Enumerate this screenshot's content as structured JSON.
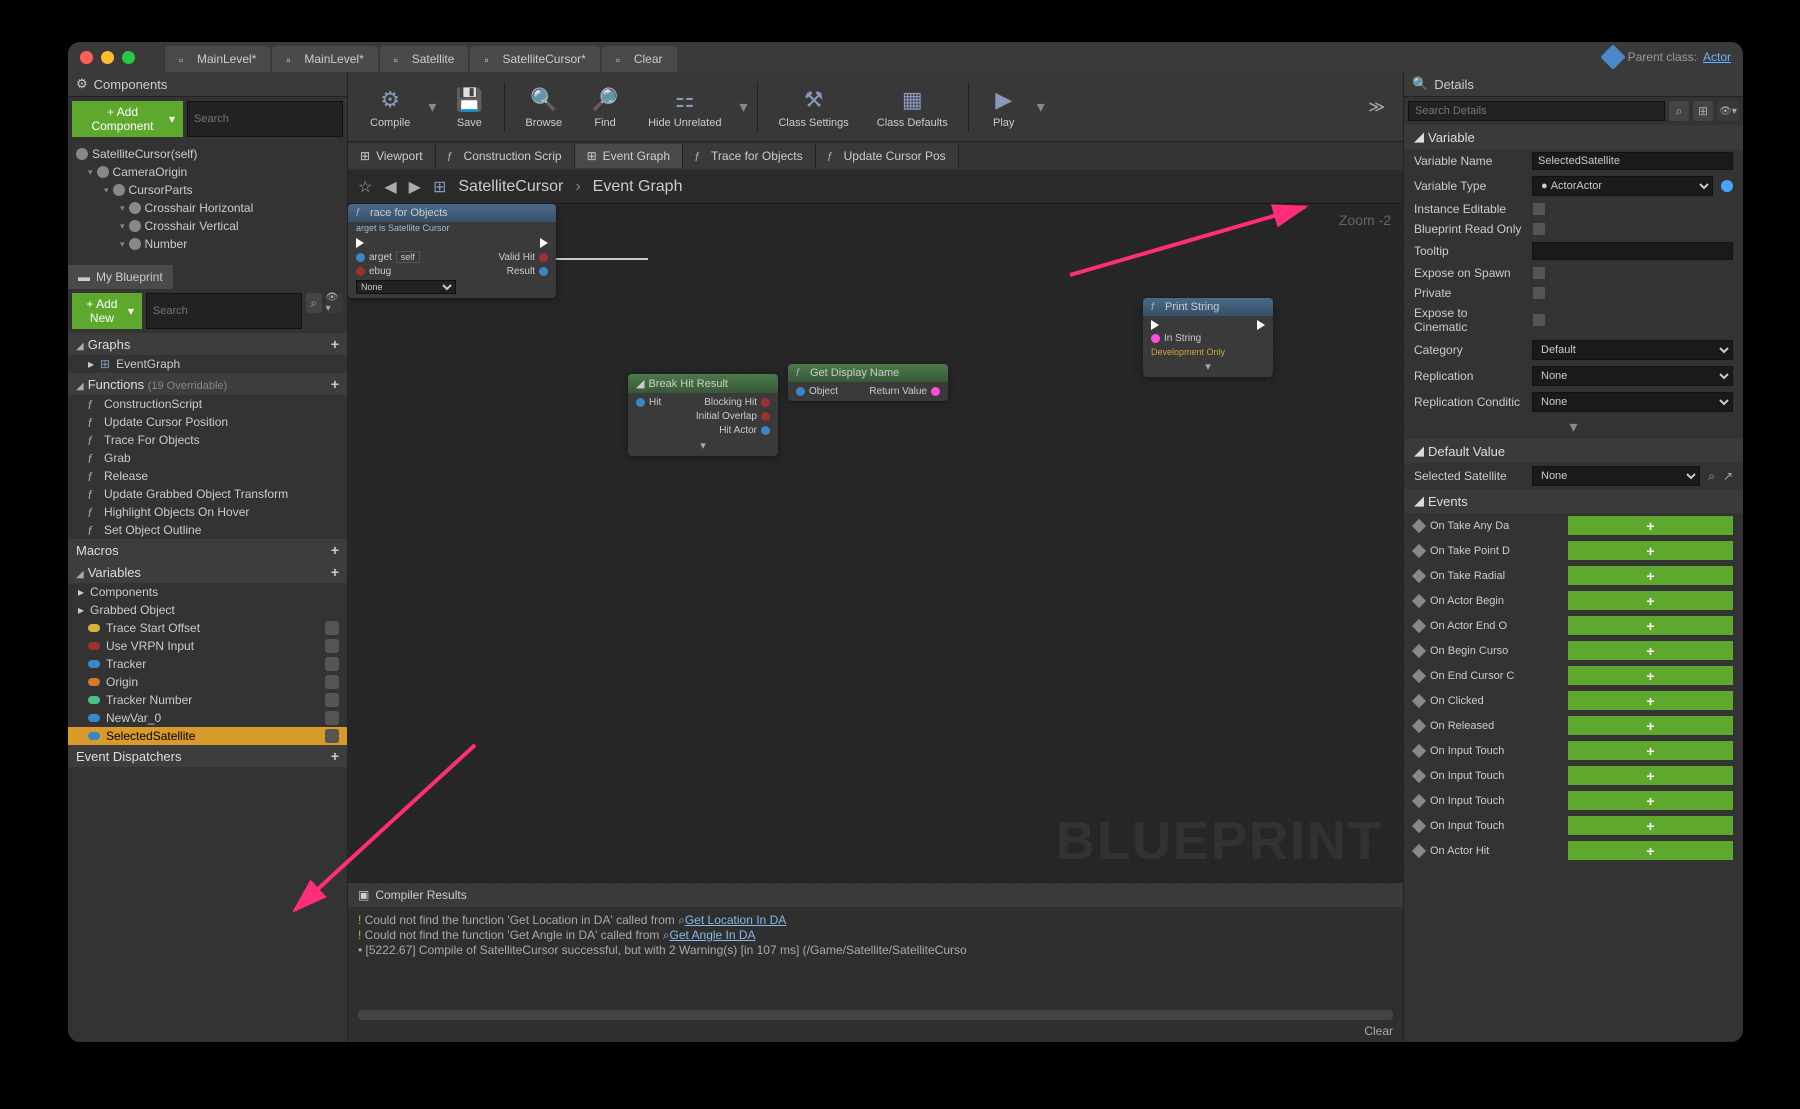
{
  "titlebar": {
    "tabs": [
      {
        "icon": "level",
        "label": "MainLevel*"
      },
      {
        "icon": "level",
        "label": "MainLevel*"
      },
      {
        "icon": "bp",
        "label": "Satellite"
      },
      {
        "icon": "bp",
        "label": "SatelliteCursor*"
      },
      {
        "icon": "doc",
        "label": "Clear"
      }
    ],
    "parent_class_label": "Parent class:",
    "parent_class": "Actor"
  },
  "components": {
    "header": "Components",
    "add_btn": "+ Add Component",
    "search_ph": "Search",
    "tree": [
      {
        "label": "SatelliteCursor(self)",
        "indent": 0,
        "icon": "sphere"
      },
      {
        "label": "CameraOrigin",
        "indent": 1,
        "icon": "link"
      },
      {
        "label": "CursorParts",
        "indent": 2,
        "icon": "link"
      },
      {
        "label": "Crosshair Horizontal",
        "indent": 3,
        "icon": "mesh"
      },
      {
        "label": "Crosshair Vertical",
        "indent": 3,
        "icon": "mesh"
      },
      {
        "label": "Number",
        "indent": 3,
        "icon": "text"
      }
    ]
  },
  "myblueprint": {
    "tab": "My Blueprint",
    "add_btn": "+ Add New",
    "search_ph": "Search",
    "sections": {
      "graphs": {
        "label": "Graphs",
        "items": [
          {
            "label": "EventGraph",
            "icon": "graph"
          }
        ]
      },
      "functions": {
        "label": "Functions",
        "suffix": "(19 Overridable)",
        "items": [
          {
            "label": "ConstructionScript"
          },
          {
            "label": "Update Cursor Position"
          },
          {
            "label": "Trace For Objects"
          },
          {
            "label": "Grab"
          },
          {
            "label": "Release"
          },
          {
            "label": "Update Grabbed Object Transform"
          },
          {
            "label": "Highlight Objects On Hover"
          },
          {
            "label": "Set Object Outline"
          }
        ]
      },
      "macros": {
        "label": "Macros"
      },
      "variables": {
        "label": "Variables",
        "groups": [
          {
            "label": "Components"
          },
          {
            "label": "Grabbed Object"
          }
        ],
        "items": [
          {
            "label": "Trace Start Offset",
            "color": "#d8b23a"
          },
          {
            "label": "Use VRPN Input",
            "color": "#a03030"
          },
          {
            "label": "Tracker",
            "color": "#3888c8"
          },
          {
            "label": "Origin",
            "color": "#d87828"
          },
          {
            "label": "Tracker Number",
            "color": "#48c088"
          },
          {
            "label": "NewVar_0",
            "color": "#3888c8"
          },
          {
            "label": "SelectedSatellite",
            "color": "#3888c8",
            "selected": true
          }
        ]
      },
      "dispatchers": {
        "label": "Event Dispatchers"
      }
    }
  },
  "toolbar": {
    "buttons": [
      {
        "label": "Compile",
        "icon": "compile",
        "dd": true
      },
      {
        "label": "Save",
        "icon": "save"
      },
      {
        "label": "Browse",
        "icon": "browse"
      },
      {
        "label": "Find",
        "icon": "find"
      },
      {
        "label": "Hide Unrelated",
        "icon": "hide",
        "dd": true
      },
      {
        "label": "Class Settings",
        "icon": "settings"
      },
      {
        "label": "Class Defaults",
        "icon": "defaults"
      },
      {
        "label": "Play",
        "icon": "play",
        "dd": true
      }
    ]
  },
  "subtabs": [
    {
      "label": "Viewport",
      "icon": "vp"
    },
    {
      "label": "Construction Scrip",
      "icon": "f"
    },
    {
      "label": "Event Graph",
      "icon": "eg",
      "active": true
    },
    {
      "label": "Trace for Objects",
      "icon": "f"
    },
    {
      "label": "Update Cursor Pos",
      "icon": "f"
    }
  ],
  "breadcrumb": {
    "a": "SatelliteCursor",
    "b": "Event Graph",
    "zoom": "Zoom -2"
  },
  "graph": {
    "watermark": "BLUEPRINT",
    "nodes": {
      "trace": {
        "title": "race for Objects",
        "sub": "arget is Satellite Cursor",
        "target": "arget",
        "self": "self",
        "debug": "ebug",
        "none": "None",
        "valid": "Valid Hit",
        "result": "Result"
      },
      "break": {
        "title": "Break Hit Result",
        "hit": "Hit",
        "blocking": "Blocking Hit",
        "overlap": "Initial Overlap",
        "actor": "Hit Actor"
      },
      "getname": {
        "title": "Get Display Name",
        "object": "Object",
        "return": "Return Value"
      },
      "print": {
        "title": "Print String",
        "instring": "In String",
        "dev": "Development Only"
      }
    }
  },
  "compiler": {
    "header": "Compiler Results",
    "lines": [
      {
        "type": "warn",
        "pre": "Could not find the function 'Get Location in DA' called from ",
        "link": "Get Location In DA"
      },
      {
        "type": "warn",
        "pre": "Could not find the function 'Get Angle in DA' called from ",
        "link": "Get Angle In DA"
      },
      {
        "type": "info",
        "pre": "[5222.67] Compile of SatelliteCursor successful, but with 2 Warning(s) [in 107 ms] (/Game/Satellite/SatelliteCurso"
      }
    ],
    "clear": "Clear"
  },
  "details": {
    "header": "Details",
    "search_ph": "Search Details",
    "variable_section": "Variable",
    "props": {
      "var_name": {
        "label": "Variable Name",
        "value": "SelectedSatellite"
      },
      "var_type": {
        "label": "Variable Type",
        "value": "Actor"
      },
      "instance_editable": {
        "label": "Instance Editable"
      },
      "bp_readonly": {
        "label": "Blueprint Read Only"
      },
      "tooltip": {
        "label": "Tooltip",
        "value": ""
      },
      "expose_spawn": {
        "label": "Expose on Spawn"
      },
      "private": {
        "label": "Private"
      },
      "expose_cine": {
        "label": "Expose to Cinematic"
      },
      "category": {
        "label": "Category",
        "value": "Default"
      },
      "replication": {
        "label": "Replication",
        "value": "None"
      },
      "rep_cond": {
        "label": "Replication Conditic",
        "value": "None"
      }
    },
    "default_value_section": "Default Value",
    "default_value": {
      "label": "Selected Satellite",
      "value": "None"
    },
    "events_section": "Events",
    "events": [
      "On Take Any Da",
      "On Take Point D",
      "On Take Radial",
      "On Actor Begin",
      "On Actor End O",
      "On Begin Curso",
      "On End Cursor C",
      "On Clicked",
      "On Released",
      "On Input Touch",
      "On Input Touch",
      "On Input Touch",
      "On Input Touch",
      "On Actor Hit"
    ]
  }
}
